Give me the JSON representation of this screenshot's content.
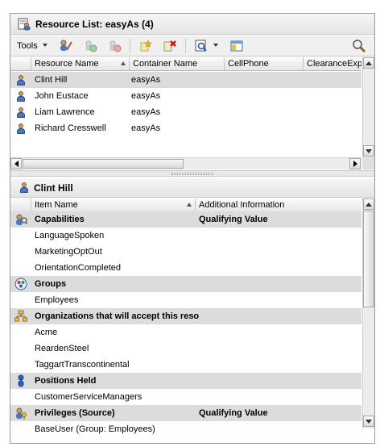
{
  "resource_list": {
    "title": "Resource List: easyAs (4)",
    "toolbar": {
      "tools_label": "Tools"
    },
    "columns": [
      "Resource Name",
      "Container Name",
      "CellPhone",
      "ClearanceExpi"
    ],
    "rows": [
      {
        "name": "Clint Hill",
        "container": "easyAs"
      },
      {
        "name": "John Eustace",
        "container": "easyAs"
      },
      {
        "name": "Liam Lawrence",
        "container": "easyAs"
      },
      {
        "name": "Richard Cresswell",
        "container": "easyAs"
      }
    ]
  },
  "detail": {
    "title": "Clint Hill",
    "columns": [
      "Item Name",
      "Additional Information"
    ],
    "categories": [
      {
        "label": "Capabilities",
        "info": "Qualifying Value",
        "icon": "capabilities-icon",
        "items": [
          "LanguageSpoken",
          "MarketingOptOut",
          "OrientationCompleted"
        ]
      },
      {
        "label": "Groups",
        "info": "",
        "icon": "groups-icon",
        "items": [
          "Employees"
        ]
      },
      {
        "label": "Organizations that will accept this resou",
        "info": "",
        "icon": "organizations-icon",
        "items": [
          "Acme",
          "ReardenSteel",
          "TaggartTranscontinental"
        ]
      },
      {
        "label": "Positions Held",
        "info": "",
        "icon": "positions-icon",
        "items": [
          "CustomerServiceManagers"
        ]
      },
      {
        "label": "Privileges (Source)",
        "info": "Qualifying Value",
        "icon": "privileges-icon",
        "items": [
          "BaseUser (Group: Employees)"
        ]
      }
    ]
  }
}
